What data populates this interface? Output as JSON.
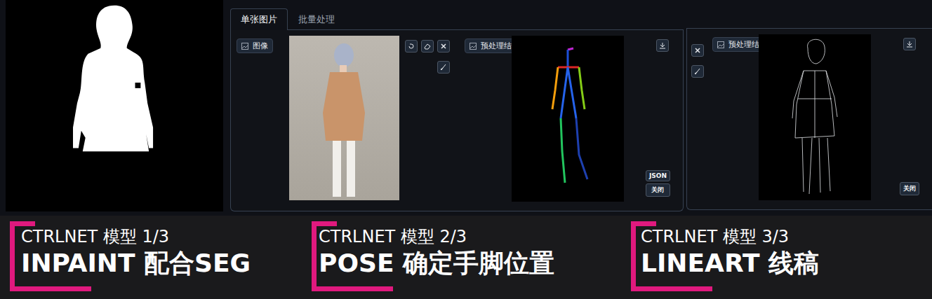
{
  "tabs": [
    {
      "label": "单张图片",
      "selected": true
    },
    {
      "label": "批量处理",
      "selected": false
    }
  ],
  "input": {
    "label": "图像"
  },
  "previews": [
    {
      "label": "预处理结果预览",
      "buttons": [
        "JSON",
        "关闭"
      ]
    },
    {
      "label": "预处理结果预览",
      "buttons": [
        "关闭"
      ]
    }
  ],
  "captions": [
    {
      "title": "CTRLNET 模型 1/3",
      "subtitle": "INPAINT 配合SEG"
    },
    {
      "title": "CTRLNET 模型 2/3",
      "subtitle": "POSE 确定手脚位置"
    },
    {
      "title": "CTRLNET 模型 3/3",
      "subtitle": "LINEART 线稿"
    }
  ]
}
